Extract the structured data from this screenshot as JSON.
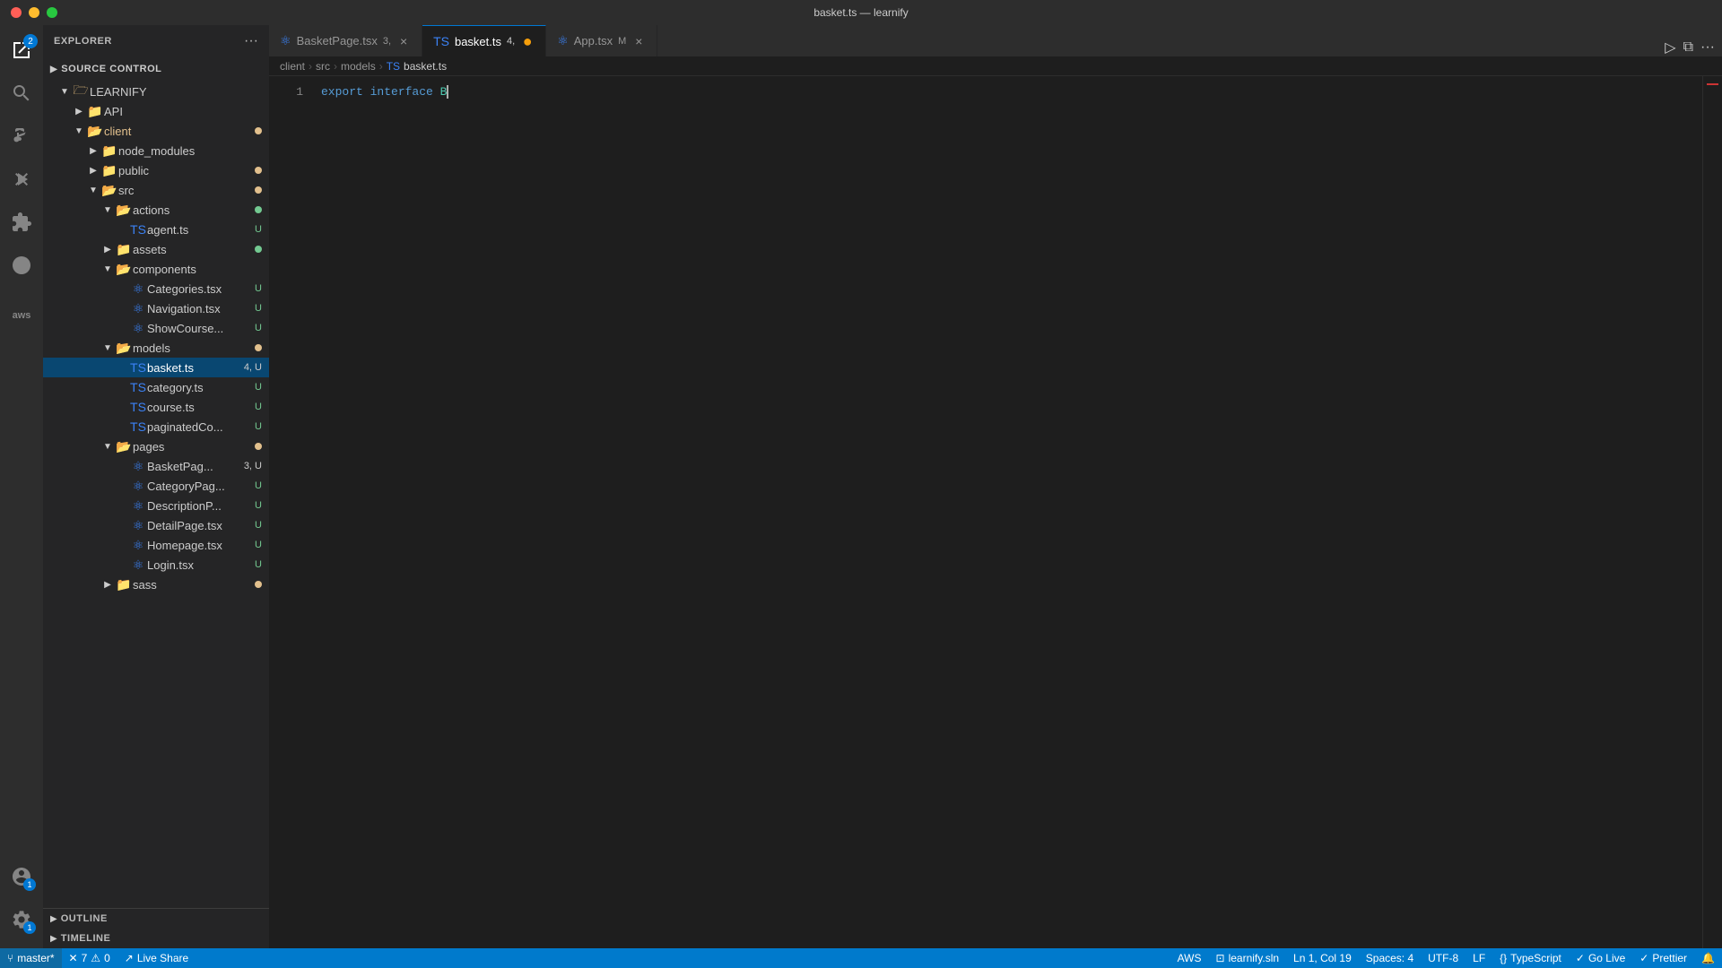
{
  "titlebar": {
    "title": "basket.ts — learnify"
  },
  "tabs": [
    {
      "id": "basketpage",
      "icon": "tsx",
      "label": "BasketPage.tsx",
      "badge": "3,",
      "close": "×",
      "active": false
    },
    {
      "id": "basket",
      "icon": "ts",
      "label": "basket.ts",
      "badge": "4,",
      "close": "●",
      "active": true
    },
    {
      "id": "app",
      "icon": "tsx",
      "label": "App.tsx",
      "badge": "M",
      "close": "×",
      "active": false
    }
  ],
  "breadcrumb": {
    "items": [
      "client",
      "src",
      "models",
      "basket.ts"
    ]
  },
  "code": {
    "line1": "export interface B"
  },
  "sidebar": {
    "explorer_title": "EXPLORER",
    "source_control_title": "SOURCE CONTROL",
    "root": "LEARNIFY",
    "outline_title": "OUTLINE",
    "timeline_title": "TIMELINE"
  },
  "tree": {
    "items": [
      {
        "id": "api",
        "label": "API",
        "type": "folder",
        "indent": 1,
        "expanded": false,
        "badge": ""
      },
      {
        "id": "client",
        "label": "client",
        "type": "folder",
        "indent": 1,
        "expanded": true,
        "badge": "dot-orange"
      },
      {
        "id": "node_modules",
        "label": "node_modules",
        "type": "folder",
        "indent": 2,
        "expanded": false,
        "badge": ""
      },
      {
        "id": "public",
        "label": "public",
        "type": "folder",
        "indent": 2,
        "expanded": false,
        "badge": "dot-orange"
      },
      {
        "id": "src",
        "label": "src",
        "type": "folder",
        "indent": 2,
        "expanded": true,
        "badge": "dot-orange"
      },
      {
        "id": "actions",
        "label": "actions",
        "type": "folder",
        "indent": 3,
        "expanded": true,
        "badge": "dot-green"
      },
      {
        "id": "agent",
        "label": "agent.ts",
        "type": "ts",
        "indent": 4,
        "badge": "U"
      },
      {
        "id": "assets",
        "label": "assets",
        "type": "folder",
        "indent": 3,
        "expanded": false,
        "badge": "dot-green"
      },
      {
        "id": "components",
        "label": "components",
        "type": "folder",
        "indent": 3,
        "expanded": true,
        "badge": ""
      },
      {
        "id": "categories",
        "label": "Categories.tsx",
        "type": "tsx",
        "indent": 4,
        "badge": "U"
      },
      {
        "id": "navigation",
        "label": "Navigation.tsx",
        "type": "tsx",
        "indent": 4,
        "badge": "U"
      },
      {
        "id": "showcourse",
        "label": "ShowCourse...",
        "type": "tsx",
        "indent": 4,
        "badge": "U"
      },
      {
        "id": "models",
        "label": "models",
        "type": "folder",
        "indent": 3,
        "expanded": true,
        "badge": "dot-orange"
      },
      {
        "id": "basket_ts",
        "label": "basket.ts",
        "type": "ts",
        "indent": 4,
        "badge": "4, U",
        "active": true
      },
      {
        "id": "category_ts",
        "label": "category.ts",
        "type": "ts",
        "indent": 4,
        "badge": "U"
      },
      {
        "id": "course_ts",
        "label": "course.ts",
        "type": "ts",
        "indent": 4,
        "badge": "U"
      },
      {
        "id": "paginated",
        "label": "paginatedCo...",
        "type": "ts",
        "indent": 4,
        "badge": "U"
      },
      {
        "id": "pages",
        "label": "pages",
        "type": "folder",
        "indent": 3,
        "expanded": true,
        "badge": "dot-orange"
      },
      {
        "id": "basketpage_tsx",
        "label": "BasketPag...",
        "type": "tsx",
        "indent": 4,
        "badge": "3, U"
      },
      {
        "id": "categorypage",
        "label": "CategoryPag...",
        "type": "tsx",
        "indent": 4,
        "badge": "U"
      },
      {
        "id": "descriptionp",
        "label": "DescriptionP...",
        "type": "tsx",
        "indent": 4,
        "badge": "U"
      },
      {
        "id": "detailpage",
        "label": "DetailPage.tsx",
        "type": "tsx",
        "indent": 4,
        "badge": "U"
      },
      {
        "id": "homepage",
        "label": "Homepage.tsx",
        "type": "tsx",
        "indent": 4,
        "badge": "U"
      },
      {
        "id": "login",
        "label": "Login.tsx",
        "type": "tsx",
        "indent": 4,
        "badge": "U"
      },
      {
        "id": "sass",
        "label": "sass",
        "type": "folder",
        "indent": 3,
        "expanded": false,
        "badge": "dot-orange"
      }
    ]
  },
  "statusbar": {
    "branch": "master*",
    "errors": "7",
    "warnings": "0",
    "liveshare": "Live Share",
    "aws": "AWS",
    "solution": "learnify.sln",
    "position": "Ln 1, Col 19",
    "spaces": "Spaces: 4",
    "encoding": "UTF-8",
    "eol": "LF",
    "language": "TypeScript",
    "golive": "Go Live",
    "prettier": "Prettier"
  },
  "activity": {
    "explorer_badge": "2",
    "account_badge": "1",
    "settings_badge": "1"
  }
}
